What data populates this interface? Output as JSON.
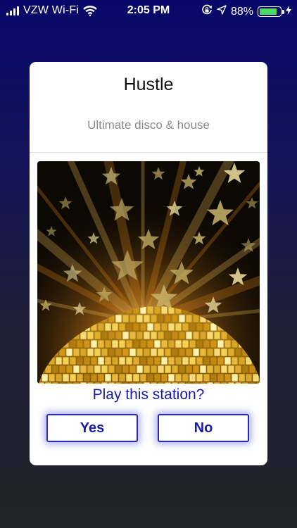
{
  "status_bar": {
    "carrier": "VZW Wi-Fi",
    "time": "2:05 PM",
    "battery": "88%",
    "battery_level": 0.88,
    "icons": [
      "signal-icon",
      "wifi-icon",
      "orientation-lock-icon",
      "location-arrow-icon",
      "battery-icon",
      "charging-bolt-icon"
    ],
    "colors": {
      "battery_fill": "#4cd964"
    }
  },
  "dialog": {
    "title": "Hustle",
    "subtitle": "Ultimate disco & house",
    "artwork": "disco-ball-stars-artwork",
    "prompt": "Play this station?",
    "yes_label": "Yes",
    "no_label": "No",
    "colors": {
      "prompt_text": "#1a1aaa",
      "button_border": "#2a2ab8"
    }
  },
  "background": {
    "top_color": "#07086a",
    "bottom_color": "#222428"
  }
}
